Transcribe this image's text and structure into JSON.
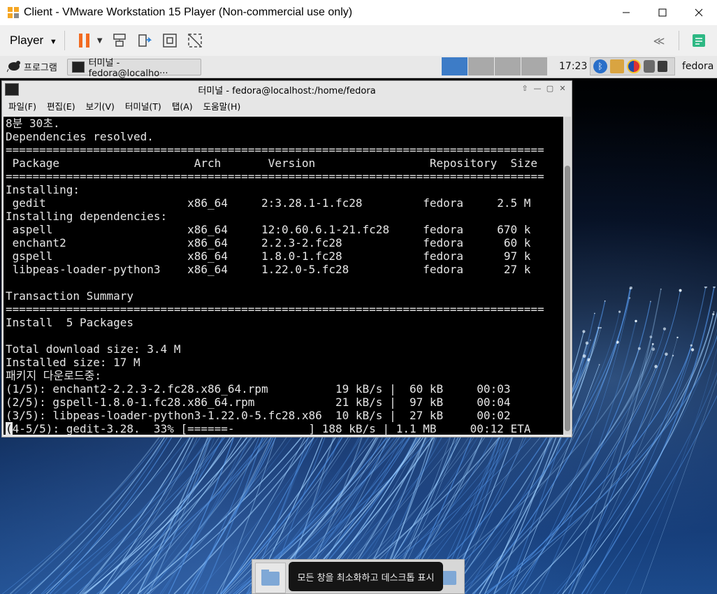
{
  "vm": {
    "title": "Client - VMware Workstation 15 Player (Non-commercial use only)",
    "player_menu": "Player"
  },
  "panel": {
    "apps_label": "프로그램",
    "task_label": "터미널 - fedora@localho···",
    "clock": "17:23",
    "user": "fedora"
  },
  "terminal": {
    "title": "터미널 - fedora@localhost:/home/fedora",
    "menu": [
      "파일(F)",
      "편집(E)",
      "보기(V)",
      "터미널(T)",
      "탭(A)",
      "도움말(H)"
    ],
    "lines": [
      "8분 30초.",
      "Dependencies resolved.",
      "================================================================================",
      " Package                    Arch       Version                 Repository  Size",
      "================================================================================",
      "Installing:",
      " gedit                     x86_64     2:3.28.1-1.fc28         fedora     2.5 M",
      "Installing dependencies:",
      " aspell                    x86_64     12:0.60.6.1-21.fc28     fedora     670 k",
      " enchant2                  x86_64     2.2.3-2.fc28            fedora      60 k",
      " gspell                    x86_64     1.8.0-1.fc28            fedora      97 k",
      " libpeas-loader-python3    x86_64     1.22.0-5.fc28           fedora      27 k",
      "",
      "Transaction Summary",
      "================================================================================",
      "Install  5 Packages",
      "",
      "Total download size: 3.4 M",
      "Installed size: 17 M",
      "패키지 다운로드중:",
      "(1/5): enchant2-2.2.3-2.fc28.x86_64.rpm          19 kB/s |  60 kB     00:03",
      "(2/5): gspell-1.8.0-1.fc28.x86_64.rpm            21 kB/s |  97 kB     00:04",
      "(3/5): libpeas-loader-python3-1.22.0-5.fc28.x86  10 kB/s |  27 kB     00:02"
    ],
    "progress_prefix": "(",
    "progress_rest": "4-5/5): gedit-3.28.  33% [======-           ] 188 kB/s | 1.1 MB     00:12 ETA"
  },
  "dock": {
    "tooltip": "모든 창을 최소화하고 데스크톱 표시"
  },
  "colors": {
    "terminal_bg": "#000000",
    "terminal_fg": "#e6e6e6",
    "pause_accent": "#f26b21",
    "active_workspace": "#3d7cc7"
  }
}
